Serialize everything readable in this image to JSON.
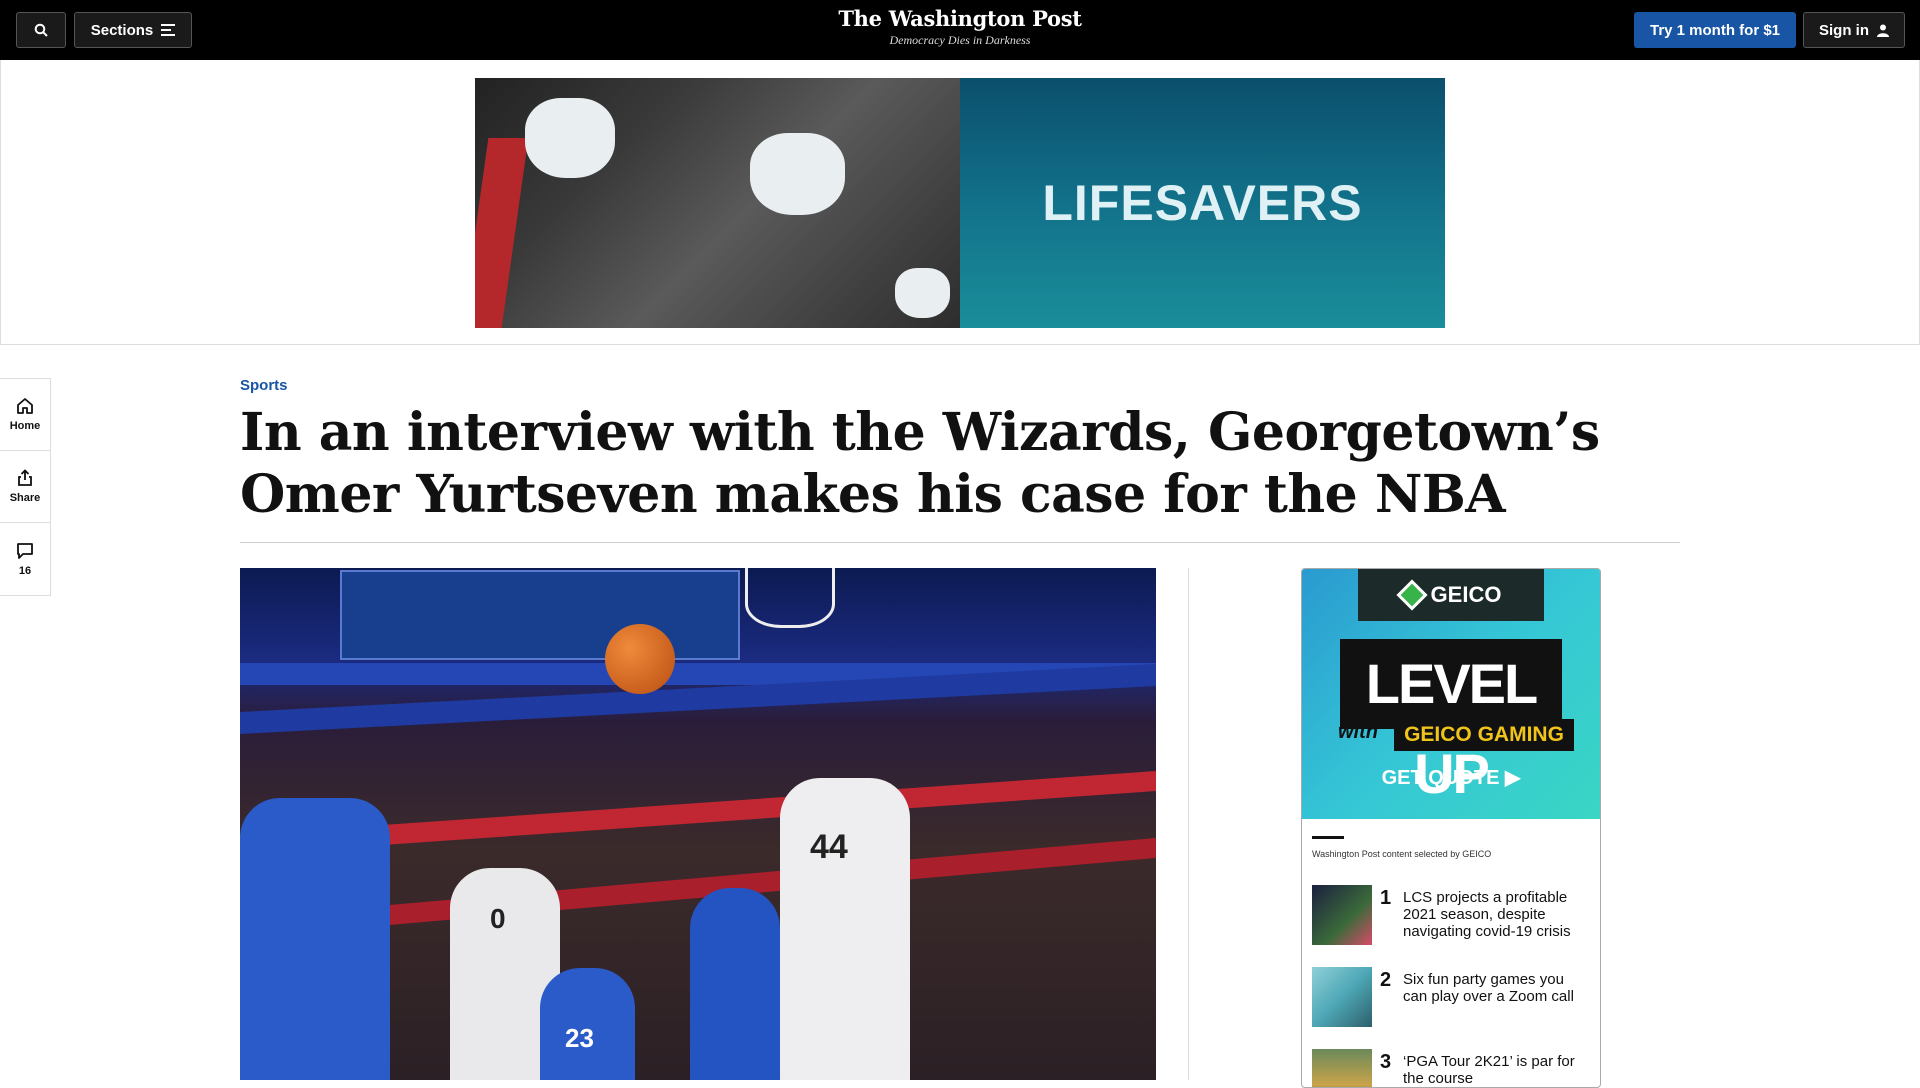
{
  "header": {
    "sections_label": "Sections",
    "logo_name": "The Washington Post",
    "tagline": "Democracy Dies in Darkness",
    "subscribe_label": "Try 1 month for $1",
    "signin_label": "Sign in"
  },
  "banner_ad": {
    "headline": "LIFESAVERS"
  },
  "rail": {
    "home_label": "Home",
    "share_label": "Share",
    "comments_count": "16"
  },
  "article": {
    "kicker": "Sports",
    "headline": "In an interview with the Wizards, Georgetown’s Omer Yurtseven makes his case for the NBA",
    "photo_jersey_1": "44",
    "photo_jersey_2": "0",
    "photo_jersey_3": "23"
  },
  "sidebar_ad": {
    "brand": "GEICO",
    "brand_sub": "GAMING",
    "title": "LEVEL UP",
    "with": "with",
    "product": "GEICO GAMING",
    "cta": "GET QUOTE ▶",
    "sponsor_note": "Washington Post content selected by GEICO",
    "items": [
      {
        "num": "1",
        "text": "LCS projects a profitable 2021 season, despite navigating covid-19 crisis"
      },
      {
        "num": "2",
        "text": "Six fun party games you can play over a Zoom call"
      },
      {
        "num": "3",
        "text": "‘PGA Tour 2K21’ is par for the course"
      }
    ]
  },
  "colors": {
    "topbar": "#000000",
    "accent_blue": "#1955a5",
    "kicker": "#1955a5"
  }
}
